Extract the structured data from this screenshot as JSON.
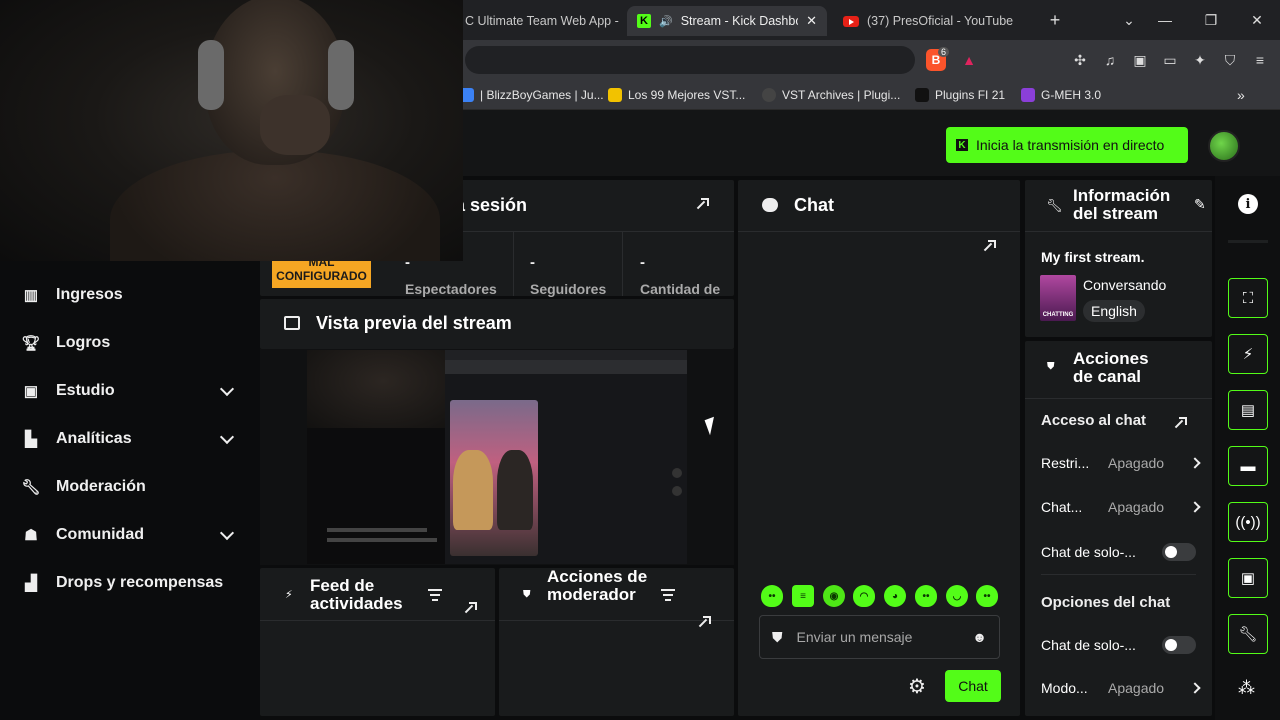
{
  "browser": {
    "tabs": [
      {
        "label": "C Ultimate Team Web App -"
      },
      {
        "label": "Stream - Kick Dashboa"
      },
      {
        "label": "(37) PresOficial - YouTube"
      }
    ],
    "bookmarks": [
      {
        "label": "| BlizzBoyGames | Ju..."
      },
      {
        "label": "Los 99 Mejores VST..."
      },
      {
        "label": "VST Archives | Plugi..."
      },
      {
        "label": "Plugins FI 21"
      },
      {
        "label": "G-MEH 3.0"
      }
    ],
    "brave_badge": "6",
    "colors": {
      "kick_green": "#53fc18",
      "warning": "#f5a623",
      "panel": "#191b1c"
    }
  },
  "header": {
    "go_live_label": "Inicia la transmisión en directo"
  },
  "sidebar": {
    "items": [
      {
        "label": "Ingresos",
        "icon": "bar-chart-icon",
        "expandable": false
      },
      {
        "label": "Logros",
        "icon": "trophy-icon",
        "expandable": false
      },
      {
        "label": "Estudio",
        "icon": "studio-icon",
        "expandable": true
      },
      {
        "label": "Analíticas",
        "icon": "analytics-icon",
        "expandable": true
      },
      {
        "label": "Moderación",
        "icon": "wrench-icon",
        "expandable": false
      },
      {
        "label": "Comunidad",
        "icon": "community-icon",
        "expandable": true
      },
      {
        "label": "Drops y recompensas",
        "icon": "drops-icon",
        "expandable": false
      }
    ]
  },
  "session": {
    "title_partial": "a sesión",
    "status_badge": "MAL\nCONFIGURADO",
    "stats": [
      {
        "value": "-",
        "label": "Espectadores"
      },
      {
        "value": "-",
        "label": "Seguidores"
      },
      {
        "value": "-",
        "label": "Cantidad de"
      }
    ]
  },
  "preview": {
    "title": "Vista previa del stream"
  },
  "feed": {
    "title": "Feed de actividades"
  },
  "mod_actions": {
    "title": "Acciones de moderador"
  },
  "chat": {
    "title": "Chat",
    "input_placeholder": "Enviar un mensaje",
    "send_label": "Chat",
    "emotes": [
      "emote-1",
      "emote-2",
      "emote-3",
      "emote-4",
      "emote-5",
      "emote-6",
      "emote-7",
      "emote-8"
    ]
  },
  "stream_info": {
    "title": "Información del stream",
    "stream_title": "My first stream.",
    "category": "Conversando",
    "language": "English",
    "thumb_text": "CHATTING"
  },
  "channel_actions": {
    "title": "Acciones de canal",
    "chat_access_heading": "Acceso al chat",
    "rows": [
      {
        "label": "Restri...",
        "value": "Apagado"
      },
      {
        "label": "Chat...",
        "value": "Apagado"
      }
    ],
    "toggle_row": {
      "label": "Chat de solo-...",
      "on": false
    },
    "chat_options_heading": "Opciones del chat",
    "options_toggle_row": {
      "label": "Chat de solo-...",
      "on": false
    },
    "mode_row": {
      "label": "Modo...",
      "value": "Apagado"
    }
  }
}
